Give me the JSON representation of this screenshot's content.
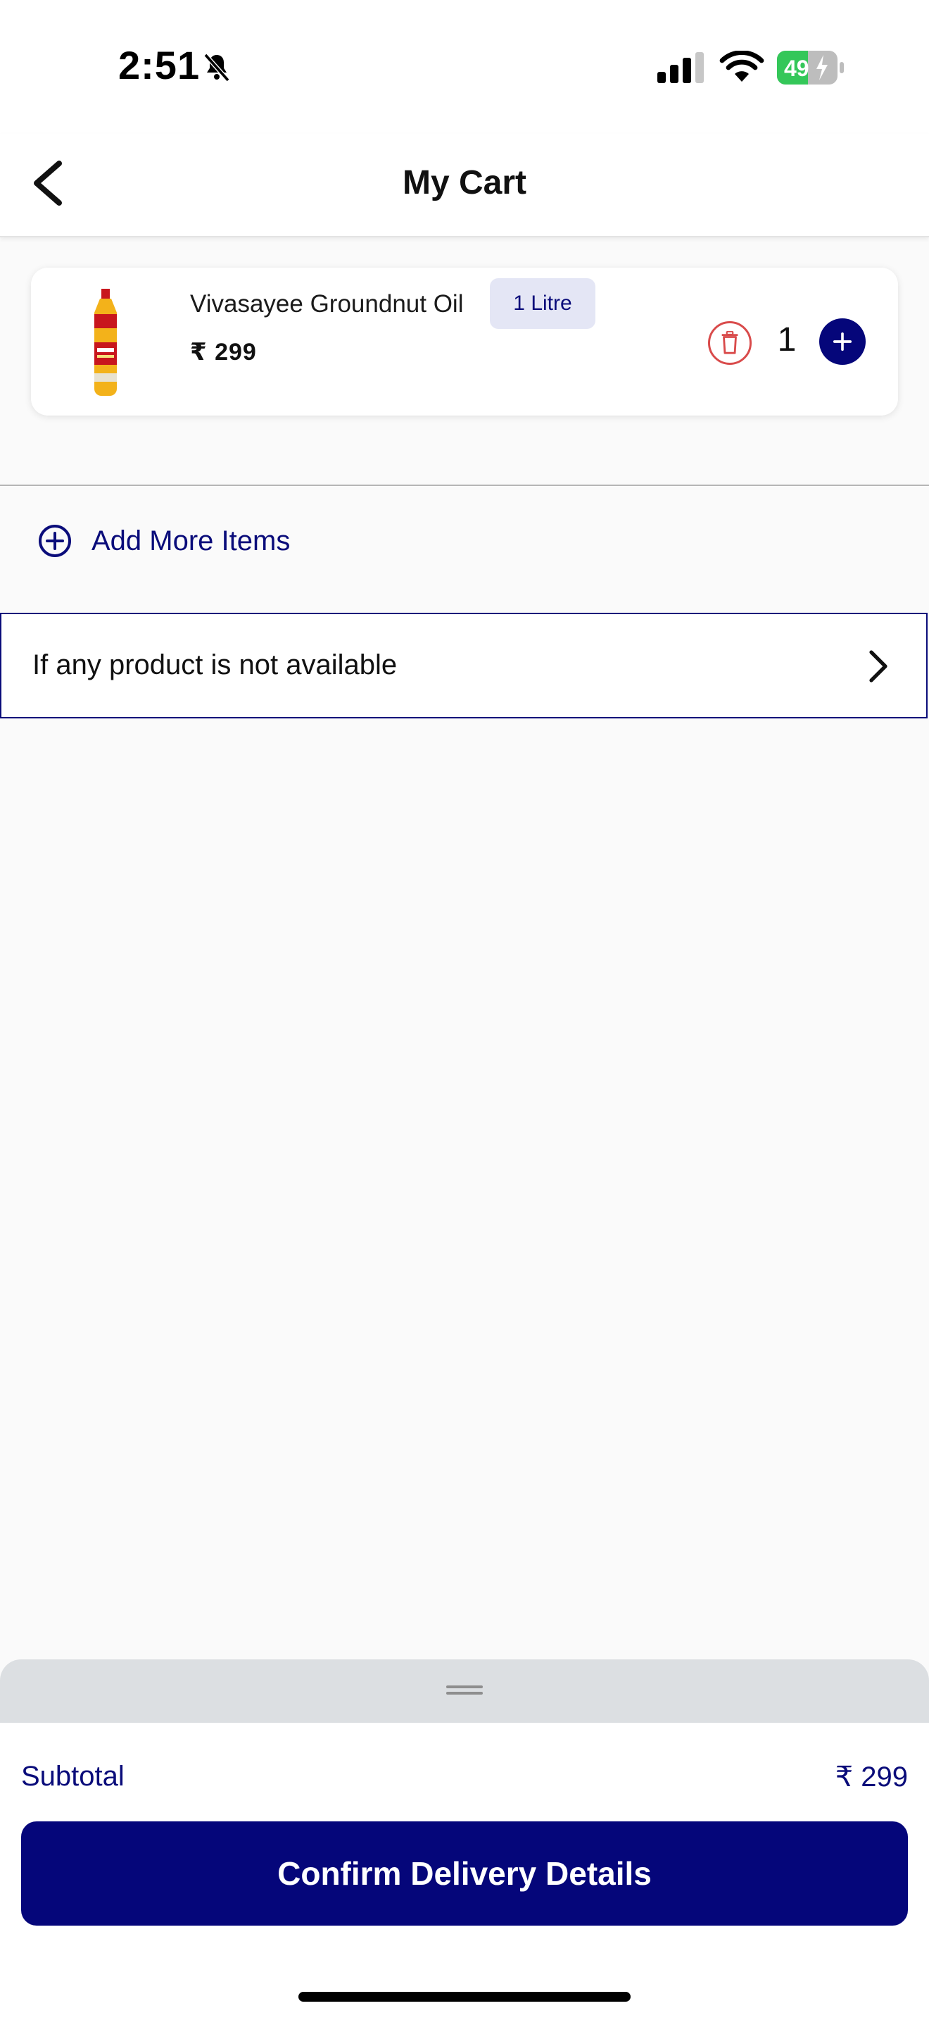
{
  "status_bar": {
    "time": "2:51",
    "battery_level": "49"
  },
  "header": {
    "title": "My Cart"
  },
  "cart": {
    "items": [
      {
        "name": "Vivasayee Groundnut Oil",
        "size": "1 Litre",
        "price": "₹ 299",
        "quantity": "1"
      }
    ]
  },
  "actions": {
    "add_more_label": "Add More Items",
    "unavailable_label": "If any product is not available"
  },
  "summary": {
    "subtotal_label": "Subtotal",
    "subtotal_value": "₹ 299",
    "confirm_label": "Confirm Delivery Details"
  },
  "colors": {
    "brand": "#05067a",
    "delete": "#d94b4b",
    "badge_bg": "#e4e6f5",
    "battery_green": "#34c759"
  },
  "icons": [
    "bell-slash-icon",
    "cellular-signal-icon",
    "wifi-icon",
    "battery-icon",
    "back-arrow-icon",
    "trash-icon",
    "plus-icon",
    "add-circle-icon",
    "chevron-right-icon",
    "grip-icon"
  ]
}
